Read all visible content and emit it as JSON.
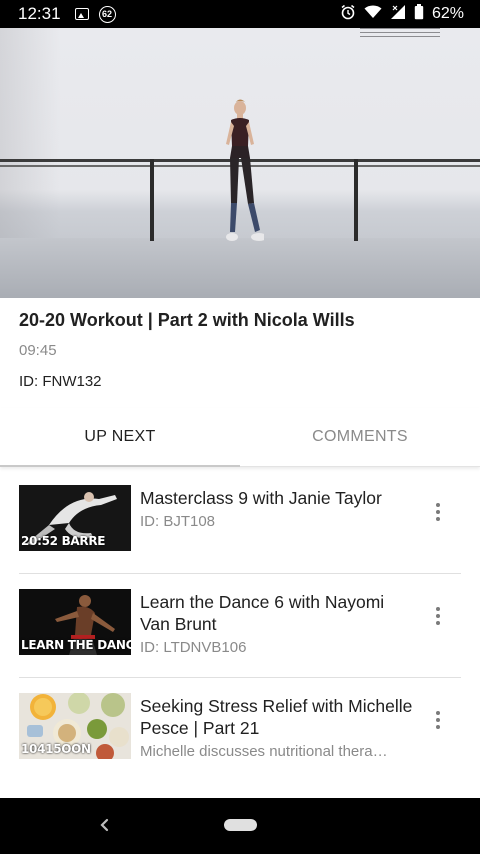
{
  "status_bar": {
    "time": "12:31",
    "notification_badge": "62",
    "battery_percent": "62%",
    "icons": [
      "image-icon",
      "notification-badge-icon",
      "alarm-icon",
      "wifi-icon",
      "signal-icon",
      "battery-icon"
    ]
  },
  "video": {
    "title": "20-20 Workout | Part 2 with Nicola Wills",
    "duration": "09:45",
    "id": "ID: FNW132"
  },
  "tabs": [
    {
      "label": "UP NEXT",
      "active": true
    },
    {
      "label": "COMMENTS",
      "active": false
    }
  ],
  "up_next": [
    {
      "title": "Masterclass 9 with Janie Taylor",
      "subtitle": "ID: BJT108",
      "thumb_label": "20:52 BARRE"
    },
    {
      "title": "Learn the Dance 6 with Nayomi Van Brunt",
      "subtitle": "ID: LTDNVB106",
      "thumb_label": "LEARN THE DANCE"
    },
    {
      "title": "Seeking Stress Relief with Michelle Pesce | Part 21",
      "subtitle": "Michelle discusses nutritional thera…",
      "thumb_label": "10415OON"
    }
  ],
  "colors": {
    "accent_underline": "#c9c9c9",
    "text_primary": "#212121",
    "text_secondary": "#8a8a8a"
  }
}
